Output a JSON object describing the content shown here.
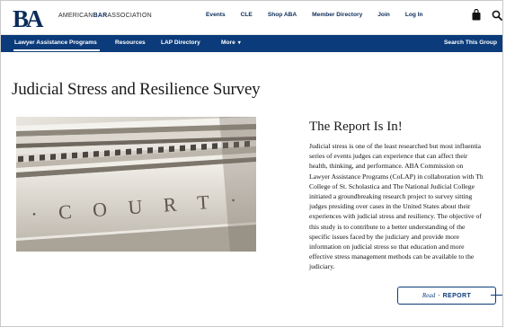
{
  "brand": {
    "mark": "BA",
    "name_prefix": "AMERICAN",
    "name_bold": "BAR",
    "name_suffix": "ASSOCIATION"
  },
  "top_nav": [
    {
      "label": "Events"
    },
    {
      "label": "CLE"
    },
    {
      "label": "Shop ABA"
    },
    {
      "label": "Member Directory"
    },
    {
      "label": "Join"
    },
    {
      "label": "Log In"
    }
  ],
  "icons": {
    "bag": "shopping-bag-icon",
    "search": "search-icon"
  },
  "colors": {
    "primary": "#0b3b7a",
    "nav_text": "#0b2c59",
    "text": "#1a1a1a"
  },
  "section_nav": {
    "active": "Lawyer Assistance Programs",
    "resources": "Resources",
    "lap_directory": "LAP Directory",
    "more": "More",
    "more_caret": "▾",
    "search": "Search This Group"
  },
  "page": {
    "title": "Judicial Stress and Resilience Survey",
    "photo_caption_text": "· C O U R T · H"
  },
  "report": {
    "heading": "The Report Is In!",
    "body_lines": [
      "Judicial stress is one of the least researched but most influentia",
      "series of events judges can experience that can affect their",
      "health, thinking, and performance. ABA Commission on",
      "Lawyer Assistance Programs (CoLAP) in collaboration with Th",
      "College of St. Scholastica and The National Judicial College",
      "initiated a groundbreaking research project to survey sitting",
      "judges presiding over cases in the United States about their",
      "experiences with judicial stress and resiliency. The objective of",
      "this study is to contribute to a better understanding of the",
      "specific issues faced by the judiciary and provide more",
      "information on judicial stress so that education and more",
      "effective stress management methods can be available to the",
      "judiciary."
    ],
    "button_read": "Read",
    "button_dash": "-",
    "button_report": "REPORT"
  }
}
